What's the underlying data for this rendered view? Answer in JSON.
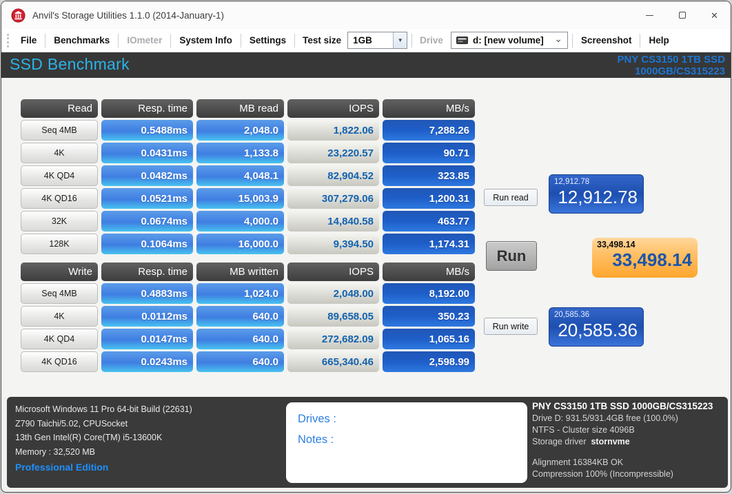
{
  "window": {
    "title": "Anvil's Storage Utilities 1.1.0 (2014-January-1)",
    "controls": {
      "close_glyph": "✕"
    }
  },
  "icons": {
    "dropdown_arrow": "▼",
    "chevron_down": "⌄"
  },
  "menu": {
    "file": "File",
    "benchmarks": "Benchmarks",
    "iometer": "IOmeter",
    "system_info": "System Info",
    "settings": "Settings",
    "test_size_label": "Test size",
    "test_size_value": "1GB",
    "drive_label": "Drive",
    "drive_value": "d: [new volume]",
    "screenshot": "Screenshot",
    "help": "Help"
  },
  "header": {
    "title": "SSD Benchmark",
    "device_line1": "PNY CS3150 1TB SSD",
    "device_line2": "1000GB/CS315223"
  },
  "read_table": {
    "headers": [
      "Read",
      "Resp. time",
      "MB read",
      "IOPS",
      "MB/s"
    ],
    "rows": [
      {
        "label": "Seq 4MB",
        "resp": "0.5488ms",
        "mb": "2,048.0",
        "iops": "1,822.06",
        "mbs": "7,288.26"
      },
      {
        "label": "4K",
        "resp": "0.0431ms",
        "mb": "1,133.8",
        "iops": "23,220.57",
        "mbs": "90.71"
      },
      {
        "label": "4K QD4",
        "resp": "0.0482ms",
        "mb": "4,048.1",
        "iops": "82,904.52",
        "mbs": "323.85"
      },
      {
        "label": "4K QD16",
        "resp": "0.0521ms",
        "mb": "15,003.9",
        "iops": "307,279.06",
        "mbs": "1,200.31"
      },
      {
        "label": "32K",
        "resp": "0.0674ms",
        "mb": "4,000.0",
        "iops": "14,840.58",
        "mbs": "463.77"
      },
      {
        "label": "128K",
        "resp": "0.1064ms",
        "mb": "16,000.0",
        "iops": "9,394.50",
        "mbs": "1,174.31"
      }
    ]
  },
  "write_table": {
    "headers": [
      "Write",
      "Resp. time",
      "MB written",
      "IOPS",
      "MB/s"
    ],
    "rows": [
      {
        "label": "Seq 4MB",
        "resp": "0.4883ms",
        "mb": "1,024.0",
        "iops": "2,048.00",
        "mbs": "8,192.00"
      },
      {
        "label": "4K",
        "resp": "0.0112ms",
        "mb": "640.0",
        "iops": "89,658.05",
        "mbs": "350.23"
      },
      {
        "label": "4K QD4",
        "resp": "0.0147ms",
        "mb": "640.0",
        "iops": "272,682.09",
        "mbs": "1,065.16"
      },
      {
        "label": "4K QD16",
        "resp": "0.0243ms",
        "mb": "640.0",
        "iops": "665,340.46",
        "mbs": "2,598.99"
      }
    ]
  },
  "actions": {
    "run_read": "Run read",
    "run": "Run",
    "run_write": "Run write"
  },
  "scores": {
    "read": {
      "small": "12,912.78",
      "large": "12,912.78"
    },
    "total": {
      "small": "33,498.14",
      "large": "33,498.14"
    },
    "write": {
      "small": "20,585.36",
      "large": "20,585.36"
    }
  },
  "footer": {
    "system": [
      "Microsoft Windows 11 Pro 64-bit Build (22631)",
      "Z790 Taichi/5.02, CPUSocket",
      "13th Gen Intel(R) Core(TM) i5-13600K",
      "Memory : 32,520 MB"
    ],
    "edition": "Professional Edition",
    "drives_label": "Drives :",
    "notes_label": "Notes :",
    "device_heading": "PNY CS3150 1TB SSD 1000GB/CS315223",
    "drive_info": [
      "Drive D: 931.5/931.4GB free (100.0%)",
      "NTFS - Cluster size 4096B"
    ],
    "storage_driver_label": "Storage driver",
    "storage_driver_value": "stornvme",
    "alignment": "Alignment 16384KB OK",
    "compression": "Compression 100% (Incompressible)"
  },
  "colors": {
    "accent_cyan": "#2ab4e8",
    "device_blue": "#1c76d4",
    "cell_blue": "#3f7ee2",
    "mbs_blue": "#1e5ec8",
    "iops_text": "#1463ae",
    "score_blue": "#1d4fb0",
    "score_orange": "#ffaa33",
    "edition_blue": "#1e90ff",
    "notes_blue": "#2e7fe0"
  }
}
